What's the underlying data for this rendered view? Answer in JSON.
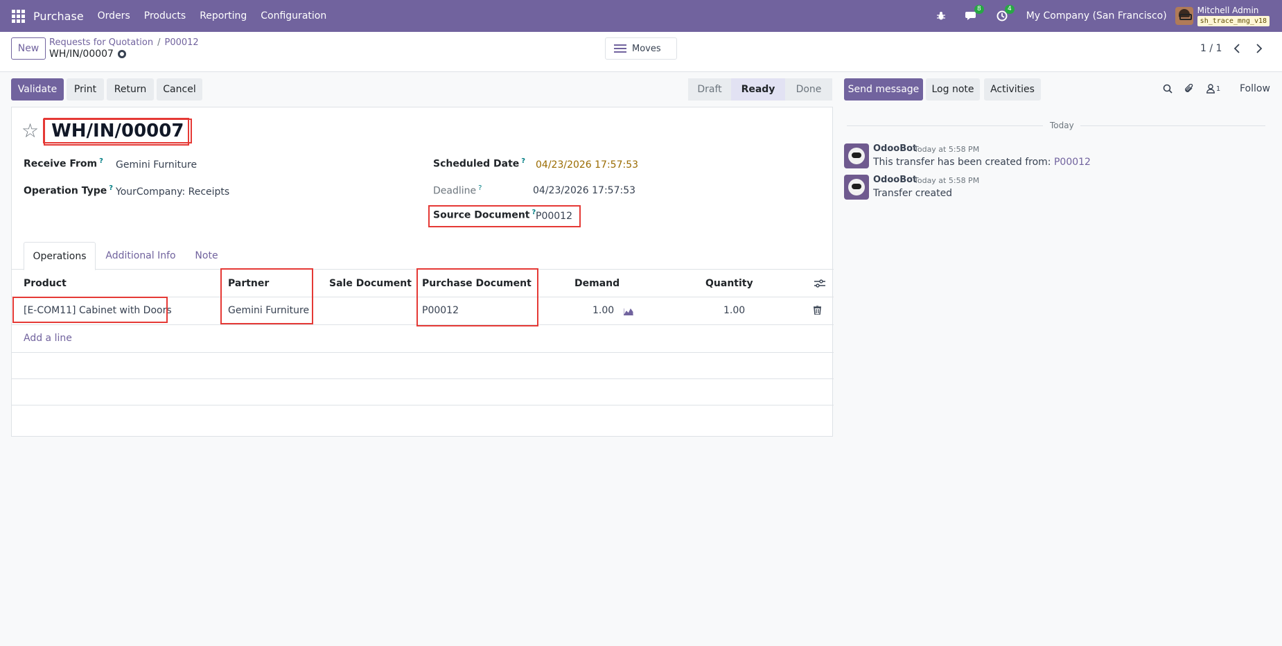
{
  "navbar": {
    "app_name": "Purchase",
    "menu": [
      "Orders",
      "Products",
      "Reporting",
      "Configuration"
    ],
    "messages_count": "8",
    "activities_count": "4",
    "company": "My Company (San Francisco)",
    "user_name": "Mitchell Admin",
    "database": "sh_trace_mng_v18",
    "accent_color": "#71639e"
  },
  "control_panel": {
    "new_label": "New",
    "breadcrumb": [
      "Requests for Quotation",
      "P00012"
    ],
    "breadcrumb_sep": "/",
    "record_name": "WH/IN/00007",
    "moves_label": "Moves",
    "pager": "1 / 1"
  },
  "actions": {
    "validate": "Validate",
    "print": "Print",
    "return": "Return",
    "cancel": "Cancel"
  },
  "statusbar": {
    "stages": [
      "Draft",
      "Ready",
      "Done"
    ],
    "current": "Ready"
  },
  "form": {
    "title": "WH/IN/00007",
    "receive_from_label": "Receive From",
    "receive_from": "Gemini Furniture",
    "operation_type_label": "Operation Type",
    "operation_type": "YourCompany: Receipts",
    "scheduled_date_label": "Scheduled Date",
    "scheduled_date": "04/23/2026 17:57:53",
    "deadline_label": "Deadline",
    "deadline": "04/23/2026 17:57:53",
    "source_document_label": "Source Document",
    "source_document": "P00012",
    "help_mark": "?"
  },
  "tabs": [
    "Operations",
    "Additional Info",
    "Note"
  ],
  "operations": {
    "columns": [
      "Product",
      "Partner",
      "Sale Document",
      "Purchase Document",
      "Demand",
      "Quantity"
    ],
    "rows": [
      {
        "product": "[E-COM11] Cabinet with Doors",
        "partner": "Gemini Furniture",
        "sale_document": "",
        "purchase_document": "P00012",
        "demand": "1.00",
        "quantity": "1.00"
      }
    ],
    "add_line": "Add a line"
  },
  "chatter": {
    "send_message": "Send message",
    "log_note": "Log note",
    "activities": "Activities",
    "followers_count": "1",
    "follow": "Follow",
    "date_separator": "Today",
    "messages": [
      {
        "author": "OdooBot",
        "time": "Today at 5:58 PM",
        "text": "This transfer has been created from: ",
        "link": "P00012"
      },
      {
        "author": "OdooBot",
        "time": "Today at 5:58 PM",
        "text": "Transfer created",
        "link": ""
      }
    ]
  }
}
